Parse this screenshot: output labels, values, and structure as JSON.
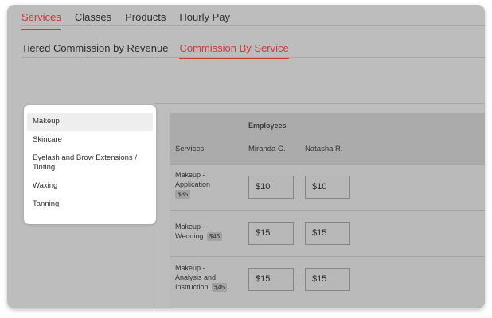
{
  "top_tabs": [
    {
      "label": "Services",
      "active": true
    },
    {
      "label": "Classes",
      "active": false
    },
    {
      "label": "Products",
      "active": false
    },
    {
      "label": "Hourly Pay",
      "active": false
    }
  ],
  "sub_tabs": [
    {
      "label": "Tiered Commission by Revenue",
      "active": false
    },
    {
      "label": "Commission By Service",
      "active": true
    }
  ],
  "category_menu": [
    {
      "label": "Makeup",
      "active": true
    },
    {
      "label": "Skincare",
      "active": false
    },
    {
      "label": "Eyelash and Brow Extensions / Tinting",
      "active": false
    },
    {
      "label": "Waxing",
      "active": false
    },
    {
      "label": "Tanning",
      "active": false
    }
  ],
  "table": {
    "group_header": "Employees",
    "columns": [
      "Services",
      "Miranda C.",
      "Natasha R."
    ],
    "rows": [
      {
        "service": "Makeup - Application",
        "price": "$35",
        "values": [
          "$10",
          "$10"
        ]
      },
      {
        "service": "Makeup - Wedding",
        "price": "$45",
        "values": [
          "$15",
          "$15"
        ]
      },
      {
        "service": "Makeup - Analysis and Instruction",
        "price": "$45",
        "values": [
          "$15",
          "$15"
        ]
      }
    ]
  },
  "colors": {
    "accent": "#c93a3a",
    "overlay": "#bdbdbd"
  }
}
